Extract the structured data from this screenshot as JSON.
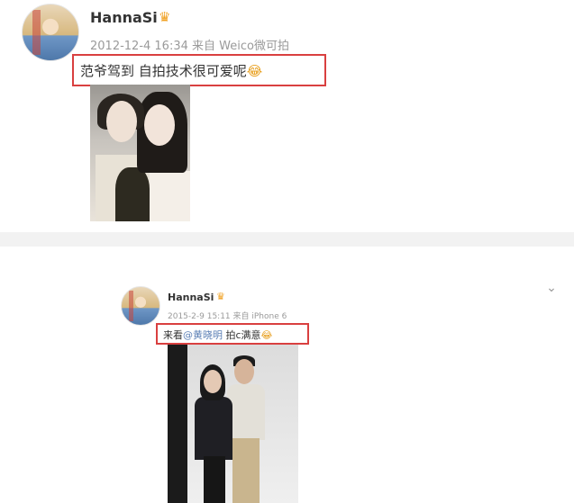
{
  "post1": {
    "username": "HannaSi",
    "badge": "crown-icon",
    "meta": "2012-12-4 16:34 来自 Weico微可拍",
    "text": "范爷驾到 自拍技术很可爱呢",
    "emoji": "😂"
  },
  "post2": {
    "username": "HannaSi",
    "badge": "crown-icon",
    "meta": "2015-2-9 15:11 来自 iPhone 6",
    "text_before": "来看",
    "mention": "@黄晓明",
    "text_after": " 拍c满意",
    "emoji": "😂"
  },
  "colors": {
    "highlight_border": "#d94040",
    "mention": "#5b7fb5",
    "meta_text": "#9a9a9a"
  }
}
